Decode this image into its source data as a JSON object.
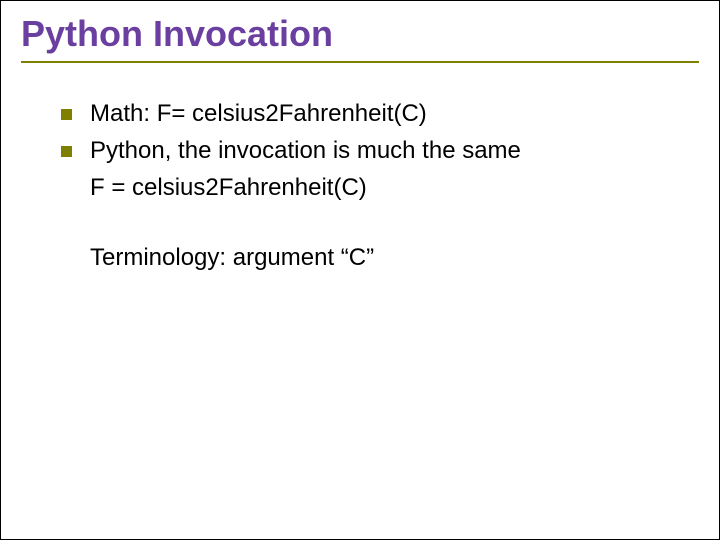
{
  "title": "Python Invocation",
  "bullets": [
    "Math: F= celsius2Fahrenheit(C)",
    "Python, the invocation is much the same"
  ],
  "sub_line": "F = celsius2Fahrenheit(C)",
  "terminology": "Terminology: argument “C”"
}
